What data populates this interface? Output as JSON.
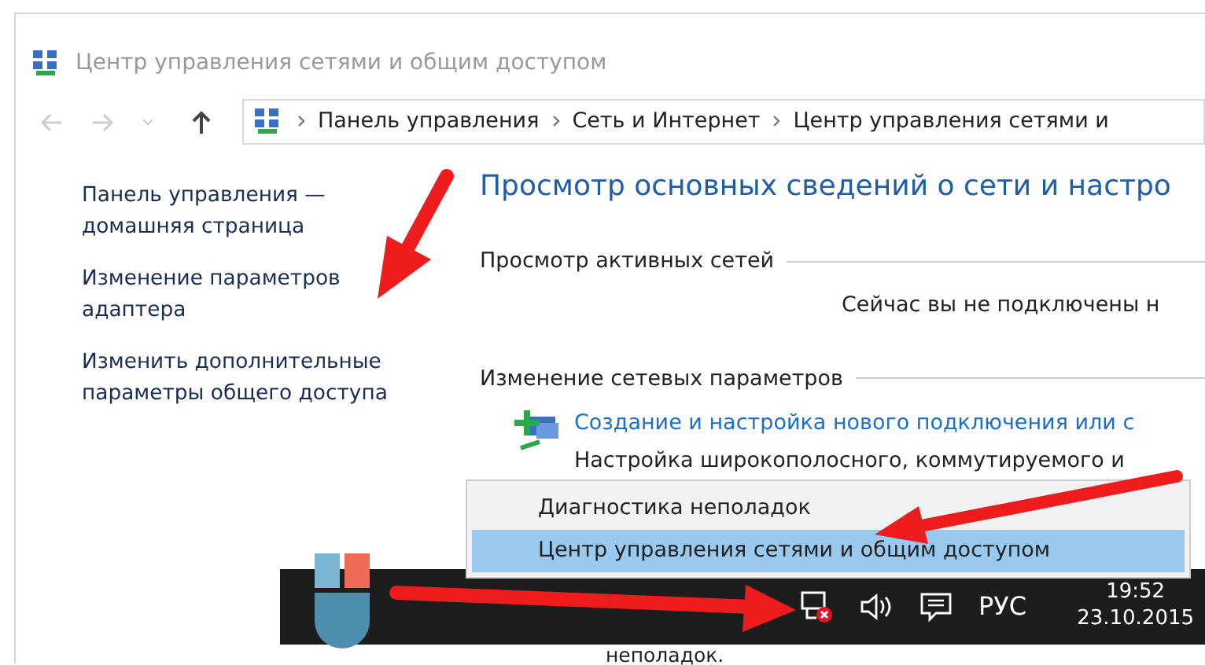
{
  "window": {
    "title": "Центр управления сетями и общим доступом"
  },
  "address_bar": {
    "breadcrumbs": [
      "Панель управления",
      "Сеть и Интернет",
      "Центр управления сетями и"
    ]
  },
  "sidebar": {
    "links": [
      "Панель управления — домашняя страница",
      "Изменение параметров адаптера",
      "Изменить дополнительные параметры общего доступа"
    ]
  },
  "main": {
    "heading": "Просмотр основных сведений о сети и настро",
    "sections": [
      {
        "title": "Просмотр активных сетей",
        "kind": "status",
        "text": "Сейчас вы не подключены н"
      },
      {
        "title": "Изменение сетевых параметров",
        "kind": "tasks",
        "tasks": [
          {
            "link": "Создание и настройка нового подключения или с",
            "description": "Настройка широкополосного, коммутируемого и"
          }
        ]
      }
    ],
    "text_below_taskbar": "неполадок."
  },
  "context_menu": {
    "items": [
      {
        "label": "Диагностика неполадок",
        "selected": false
      },
      {
        "label": "Центр управления сетями и общим доступом",
        "selected": true
      }
    ]
  },
  "taskbar": {
    "network_error": true,
    "language": "РУС",
    "time": "19:52",
    "date": "23.10.2015"
  }
}
